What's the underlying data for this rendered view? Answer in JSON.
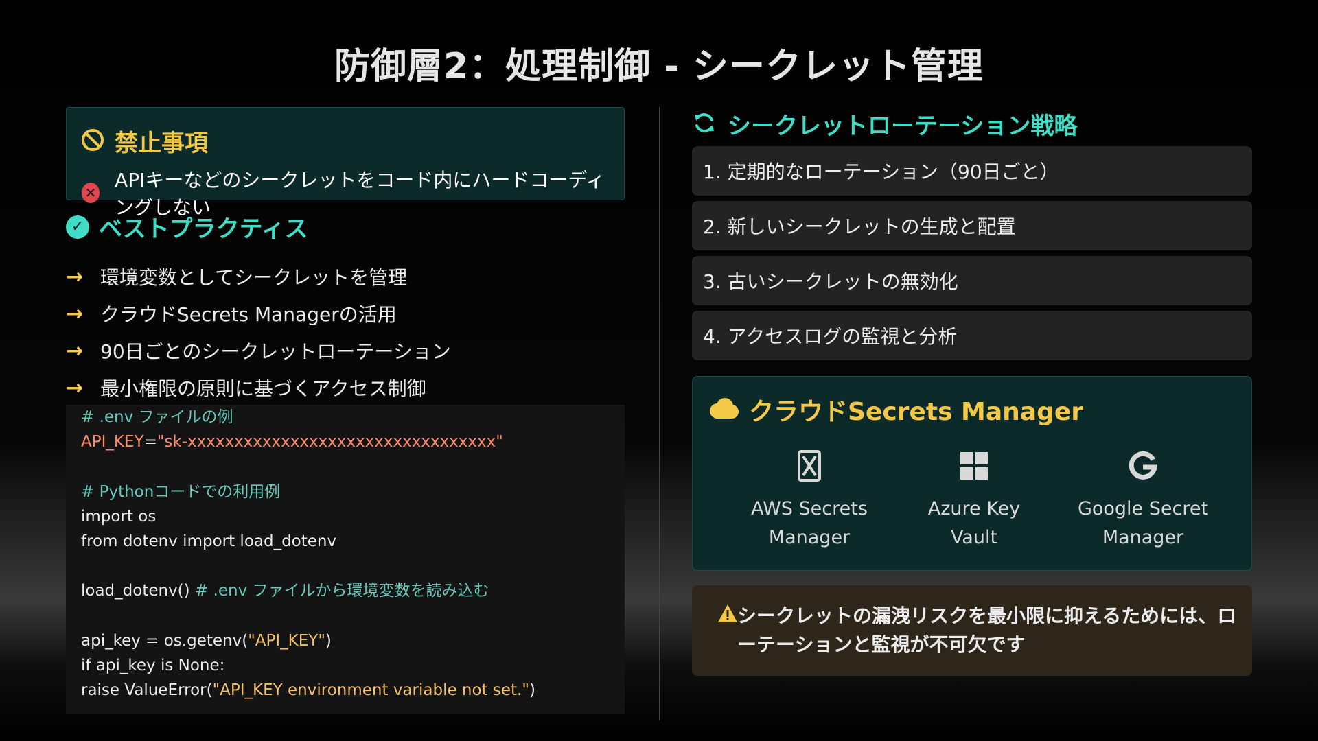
{
  "title": "防御層2：処理制御 - シークレット管理",
  "prohibited": {
    "title": "禁止事項",
    "item": "APIキーなどのシークレットをコード内にハードコーディングしない"
  },
  "best_practices": {
    "title": "ベストプラクティス",
    "items": [
      "環境変数としてシークレットを管理",
      "クラウドSecrets Managerの活用",
      "90日ごとのシークレットローテーション",
      "最小権限の原則に基づくアクセス制御"
    ]
  },
  "code": {
    "l1": "# .env ファイルの例",
    "l2_key": "API_KEY",
    "l2_eq": "=",
    "l2_val": "\"sk-xxxxxxxxxxxxxxxxxxxxxxxxxxxxxxxxx\"",
    "l4": "# Pythonコードでの利用例",
    "l5": "import os",
    "l6": "from dotenv import load_dotenv",
    "l8_code": "load_dotenv() ",
    "l8_com": "# .env ファイルから環境変数を読み込む",
    "l10_a": "api_key = os.getenv(",
    "l10_s": "\"API_KEY\"",
    "l10_b": ")",
    "l11": "if api_key is None:",
    "l12_a": "raise ValueError(",
    "l12_s": "\"API_KEY environment variable not set.\"",
    "l12_b": ")"
  },
  "rotation": {
    "title": "シークレットローテーション戦略",
    "items": [
      "1. 定期的なローテーション（90日ごと）",
      "2. 新しいシークレットの生成と配置",
      "3. 古いシークレットの無効化",
      "4. アクセスログの監視と分析"
    ]
  },
  "cloud": {
    "title": "クラウドSecrets Manager",
    "providers": [
      {
        "line1": "AWS Secrets",
        "line2": "Manager",
        "icon": "aws-icon"
      },
      {
        "line1": "Azure Key",
        "line2": "Vault",
        "icon": "windows-icon"
      },
      {
        "line1": "Google Secret",
        "line2": "Manager",
        "icon": "google-icon"
      }
    ]
  },
  "warning": {
    "text": "シークレットの漏洩リスクを最小限に抑えるためには、ローテーションと監視が不可欠です",
    "icon": "warning-icon"
  },
  "colors": {
    "accent_teal": "#3fdcc6",
    "accent_yellow": "#f4c94a",
    "danger": "#e0464f"
  }
}
